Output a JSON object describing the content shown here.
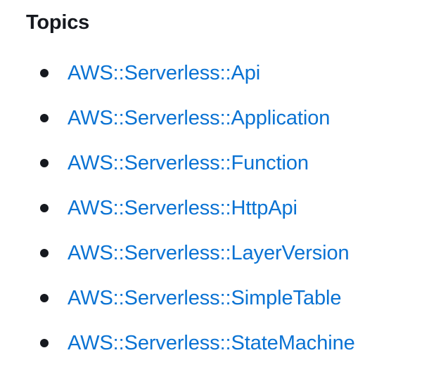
{
  "topics": {
    "title": "Topics",
    "items": [
      {
        "label": "AWS::Serverless::Api"
      },
      {
        "label": "AWS::Serverless::Application"
      },
      {
        "label": "AWS::Serverless::Function"
      },
      {
        "label": "AWS::Serverless::HttpApi"
      },
      {
        "label": "AWS::Serverless::LayerVersion"
      },
      {
        "label": "AWS::Serverless::SimpleTable"
      },
      {
        "label": "AWS::Serverless::StateMachine"
      }
    ]
  },
  "colors": {
    "link": "#0972d3",
    "text": "#16191f",
    "background": "#ffffff"
  }
}
